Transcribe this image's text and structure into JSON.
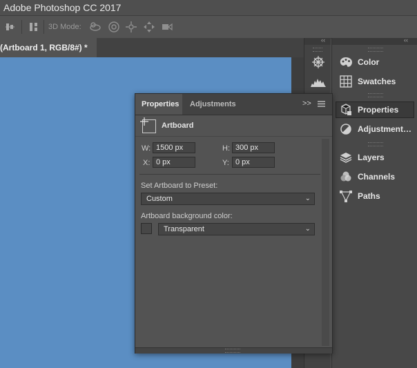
{
  "window": {
    "title": "Adobe Photoshop CC 2017"
  },
  "options_bar": {
    "mode_label": "3D Mode:"
  },
  "document": {
    "tab_label": "(Artboard 1, RGB/8#) *"
  },
  "dock": {
    "collapse_glyph": "‹‹",
    "items": [
      {
        "label": "Color",
        "icon": "palette-icon"
      },
      {
        "label": "Swatches",
        "icon": "swatches-grid-icon"
      },
      {
        "label": "Properties",
        "icon": "properties-cube-icon",
        "active": true
      },
      {
        "label": "Adjustment…",
        "icon": "adjustment-half-circle-icon"
      },
      {
        "label": "Layers",
        "icon": "layers-stack-icon"
      },
      {
        "label": "Channels",
        "icon": "channels-circles-icon"
      },
      {
        "label": "Paths",
        "icon": "paths-pen-icon"
      }
    ]
  },
  "properties_panel": {
    "tabs": [
      {
        "label": "Properties"
      },
      {
        "label": "Adjustments"
      }
    ],
    "menu_glyph": ">>",
    "section_title": "Artboard",
    "fields": {
      "w": {
        "label": "W:",
        "value": "1500 px"
      },
      "h": {
        "label": "H:",
        "value": "300 px"
      },
      "x": {
        "label": "X:",
        "value": "0 px"
      },
      "y": {
        "label": "Y:",
        "value": "0 px"
      }
    },
    "preset": {
      "label": "Set Artboard to Preset:",
      "value": "Custom"
    },
    "background": {
      "label": "Artboard background color:",
      "value": "Transparent"
    }
  },
  "colors": {
    "canvas": "#5b8ec3",
    "panel_bg": "#535353",
    "dark_bg": "#424242",
    "text": "#e6e6e6"
  }
}
